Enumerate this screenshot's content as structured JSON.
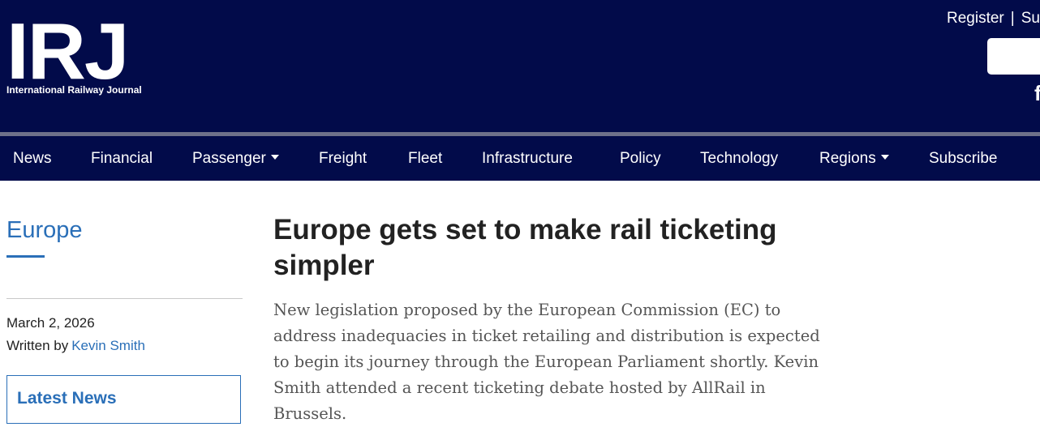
{
  "header": {
    "logo_letters": "IRJ",
    "logo_subtitle": "International Railway Journal",
    "top_links": {
      "register": "Register",
      "separator": "|",
      "subscribe_partial": "Su"
    },
    "social_icon": "facebook-icon",
    "facebook_glyph": "f"
  },
  "nav": {
    "items": [
      {
        "label": "News"
      },
      {
        "label": "Financial"
      },
      {
        "label": "Passenger"
      },
      {
        "label": "Freight"
      },
      {
        "label": "Fleet"
      },
      {
        "label": "Infrastructure"
      },
      {
        "label": "Policy"
      },
      {
        "label": "Technology"
      },
      {
        "label": "Regions"
      },
      {
        "label": "Subscribe"
      }
    ]
  },
  "sidebar": {
    "section": "Europe",
    "date": "March 2, 2026",
    "written_by": "Written by",
    "author": "Kevin Smith",
    "latest_news": "Latest News"
  },
  "article": {
    "headline": "Europe gets set to make rail ticketing simpler",
    "standfirst": "New legislation proposed by the European Commission (EC) to address inadequacies in ticket retailing and distribution is expected to begin its journey through the European Parliament shortly. Kevin Smith attended a recent ticketing debate hosted by AllRail in Brussels."
  },
  "colors": {
    "header_bg": "#020b4a",
    "accent_blue": "#2a6fb8",
    "divider": "#6e718a"
  }
}
